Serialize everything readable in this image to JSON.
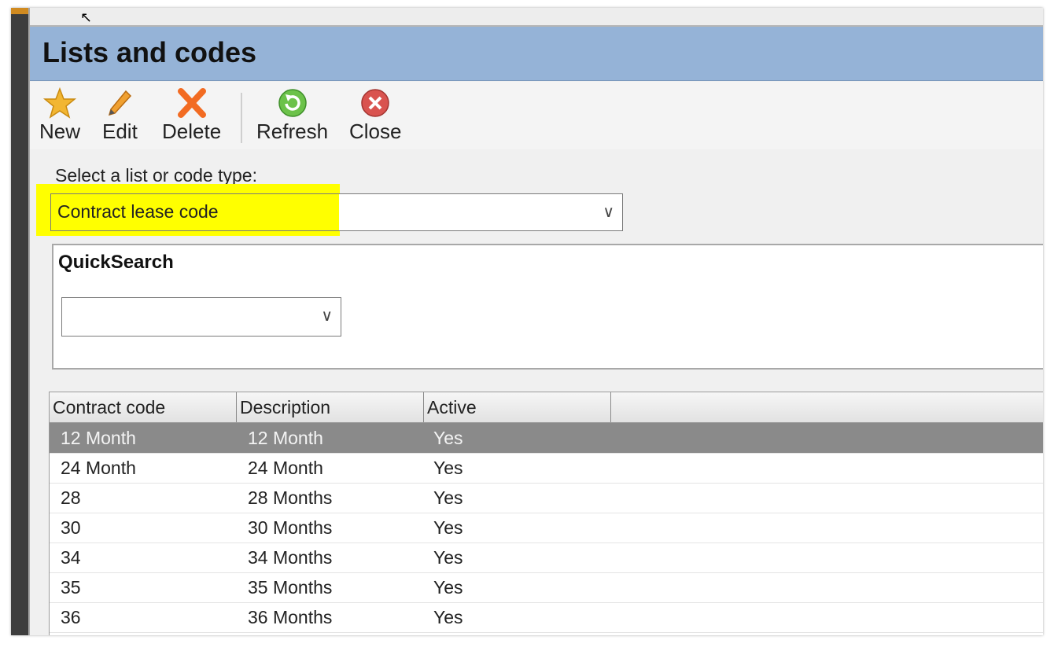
{
  "window": {
    "title": "Lists and codes"
  },
  "toolbar": {
    "new_label": "New",
    "edit_label": "Edit",
    "delete_label": "Delete",
    "refresh_label": "Refresh",
    "close_label": "Close"
  },
  "type_selector": {
    "label": "Select a list or code type:",
    "value": "Contract lease code",
    "highlight_color": "#ffff00"
  },
  "quicksearch": {
    "title": "QuickSearch",
    "value": ""
  },
  "grid": {
    "columns": [
      "Contract code",
      "Description",
      "Active"
    ],
    "rows": [
      {
        "code": "12 Month",
        "description": "12 Month",
        "active": "Yes",
        "selected": true
      },
      {
        "code": "24 Month",
        "description": "24 Month",
        "active": "Yes"
      },
      {
        "code": "28",
        "description": "28 Months",
        "active": "Yes"
      },
      {
        "code": "30",
        "description": "30 Months",
        "active": "Yes"
      },
      {
        "code": "34",
        "description": "34 Months",
        "active": "Yes"
      },
      {
        "code": "35",
        "description": "35 Months",
        "active": "Yes"
      },
      {
        "code": "36",
        "description": "36 Months",
        "active": "Yes"
      }
    ]
  },
  "colors": {
    "title_bar": "#95b3d7",
    "selected_row": "#8a8a8a"
  }
}
